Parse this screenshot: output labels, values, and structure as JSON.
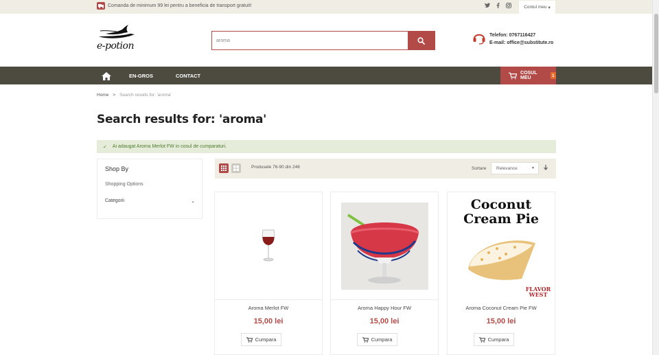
{
  "topbar": {
    "promo_text": "Comanda de minimum 99 lei pentru a beneficia de transport gratuit!",
    "social_icons": [
      "twitter-icon",
      "facebook-icon",
      "instagram-icon"
    ],
    "account_label": "Contul meu",
    "account_caret": "▾"
  },
  "header": {
    "logo_text": "e-potion",
    "search": {
      "value": "aroma"
    },
    "contact": {
      "phone": "Telefon: 0767116427",
      "email": "E-mail: office@substitute.ro"
    }
  },
  "nav": {
    "items": [
      {
        "label": "EN-GROS"
      },
      {
        "label": "CONTACT"
      }
    ],
    "cart": {
      "label": "COSUL MEU",
      "count": "1"
    }
  },
  "breadcrumb": {
    "home": "Home",
    "separator": ">",
    "current": "Search results for: 'aroma'"
  },
  "page_title": "Search results for: 'aroma'",
  "message": {
    "icon": "✓",
    "text": "Ai adaugat Aroma Merlot FW in cosul de cumparaturi."
  },
  "sidebar": {
    "title": "Shop By",
    "subtitle": "Shopping Options",
    "category_label": "Categorii",
    "chevron": "⌄"
  },
  "toolbar": {
    "amount_text": "Produsele 76-90 din 246",
    "sort_label": "Sortare",
    "sort_value": "Relevance",
    "sort_caret": "▼",
    "sort_direction": "🡣"
  },
  "products": [
    {
      "name": "Aroma Merlot FW",
      "price": "15,00 lei",
      "button": "Cumpara"
    },
    {
      "name": "Aroma Happy Hour FW",
      "price": "15,00 lei",
      "button": "Cumpara"
    },
    {
      "name": "Aroma Coconut Cream Pie FW",
      "price": "15,00 lei",
      "button": "Cumpara",
      "image_text": {
        "line1": "Coconut",
        "line2": "Cream Pie",
        "brand1": "FLAVOR",
        "brand2": "WEST"
      }
    }
  ],
  "colors": {
    "accent": "#b24a48",
    "nav_bg": "#4d4a40",
    "topbar_bg": "#f0ede4",
    "success_bg": "#e5ecd9",
    "success_text": "#4e7a2b"
  }
}
